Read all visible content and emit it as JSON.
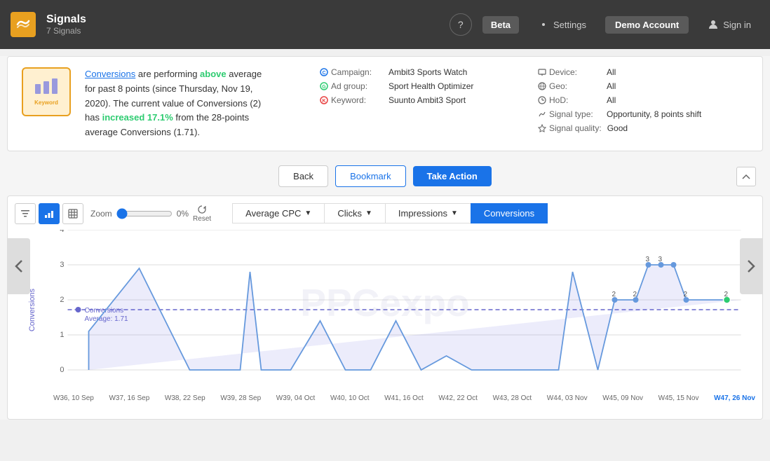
{
  "header": {
    "logo_alt": "Signals logo",
    "title": "Signals",
    "subtitle": "7 Signals",
    "help_label": "?",
    "beta_label": "Beta",
    "settings_label": "Settings",
    "account_label": "Demo Account",
    "signin_label": "Sign in"
  },
  "signal": {
    "icon_label": "Keyword",
    "description_parts": {
      "link_text": "Conversions",
      "text1": " are performing ",
      "above_text": "above",
      "text2": " average for past 8 points (since Thursday, Nov 19, 2020). The current value of Conversions (2) has ",
      "increased_text": "increased 17.1%",
      "text3": " from the 28-points average Conversions (1.71)."
    },
    "campaign_label": "Campaign:",
    "campaign_value": "Ambit3 Sports Watch",
    "adgroup_label": "Ad group:",
    "adgroup_value": "Sport Health Optimizer",
    "keyword_label": "Keyword:",
    "keyword_value": "Suunto Ambit3 Sport",
    "device_label": "Device:",
    "device_value": "All",
    "geo_label": "Geo:",
    "geo_value": "All",
    "hod_label": "HoD:",
    "hod_value": "All",
    "signal_type_label": "Signal type:",
    "signal_type_value": "Opportunity, 8 points shift",
    "signal_quality_label": "Signal quality:",
    "signal_quality_value": "Good"
  },
  "actions": {
    "back_label": "Back",
    "bookmark_label": "Bookmark",
    "take_action_label": "Take Action"
  },
  "chart": {
    "zoom_label": "Zoom",
    "zoom_value": "0%",
    "reset_label": "Reset",
    "tabs": [
      {
        "label": "Average CPC",
        "arrow": "▼",
        "active": false
      },
      {
        "label": "Clicks",
        "arrow": "▼",
        "active": false
      },
      {
        "label": "Impressions",
        "arrow": "▼",
        "active": false
      },
      {
        "label": "Conversions",
        "arrow": "",
        "active": true
      }
    ],
    "y_label": "Conversions",
    "average_label": "Conversions",
    "average_value": "Average: 1.71",
    "x_labels": [
      "W36, 10 Sep",
      "W37, 16 Sep",
      "W38, 22 Sep",
      "W39, 28 Sep",
      "W39, 04 Oct",
      "W40, 10 Oct",
      "W41, 16 Oct",
      "W42, 22 Oct",
      "W43, 28 Oct",
      "W44, 03 Nov",
      "W45, 09 Nov",
      "W45, 15 Nov",
      "W47, 26 Nov"
    ],
    "watermark": "PPCexpo"
  }
}
